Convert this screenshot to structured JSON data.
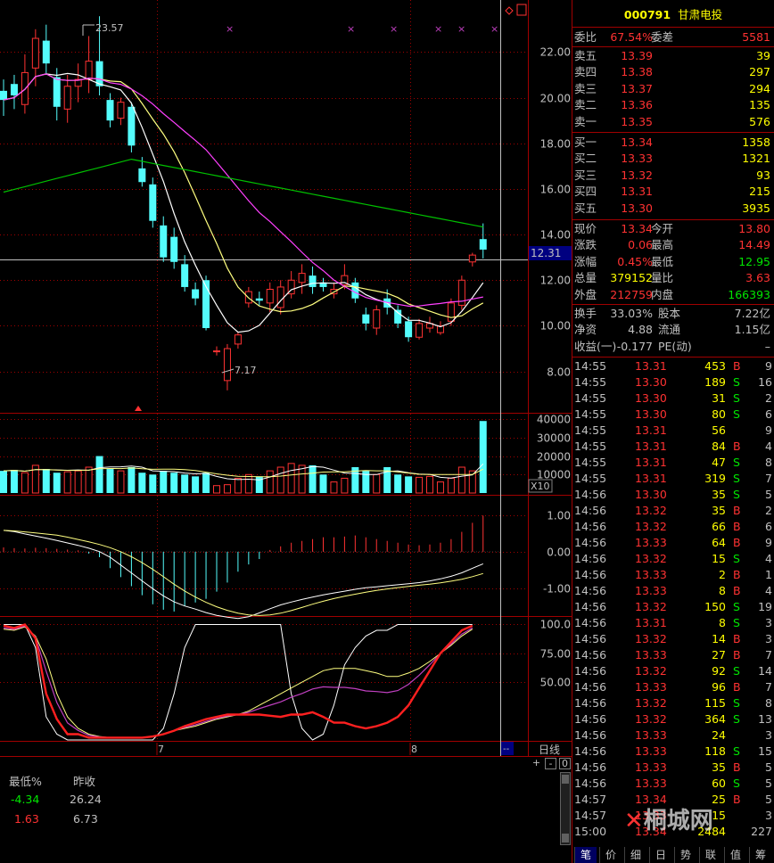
{
  "header": {
    "code": "000791",
    "name": "甘肃电投"
  },
  "quote_summary": [
    {
      "k1": "委比",
      "v1": "67.54%",
      "k2": "委差",
      "v2": "5581"
    }
  ],
  "sell_orders": [
    {
      "label": "卖五",
      "price": "13.39",
      "vol": "39"
    },
    {
      "label": "卖四",
      "price": "13.38",
      "vol": "297"
    },
    {
      "label": "卖三",
      "price": "13.37",
      "vol": "294"
    },
    {
      "label": "卖二",
      "price": "13.36",
      "vol": "135"
    },
    {
      "label": "卖一",
      "price": "13.35",
      "vol": "576"
    }
  ],
  "buy_orders": [
    {
      "label": "买一",
      "price": "13.34",
      "vol": "1358"
    },
    {
      "label": "买二",
      "price": "13.33",
      "vol": "1321"
    },
    {
      "label": "买三",
      "price": "13.32",
      "vol": "93"
    },
    {
      "label": "买四",
      "price": "13.31",
      "vol": "215"
    },
    {
      "label": "买五",
      "price": "13.30",
      "vol": "3935"
    }
  ],
  "stats": [
    {
      "k1": "现价",
      "v1": "13.34",
      "k2": "今开",
      "v2": "13.80"
    },
    {
      "k1": "涨跌",
      "v1": "0.06",
      "k2": "最高",
      "v2": "14.49"
    },
    {
      "k1": "涨幅",
      "v1": "0.45%",
      "k2": "最低",
      "v2": "12.95"
    },
    {
      "k1": "总量",
      "v1": "379152",
      "k2": "量比",
      "v2": "3.63"
    },
    {
      "k1": "外盘",
      "v1": "212759",
      "k2": "内盘",
      "v2": "166393"
    }
  ],
  "fund": [
    {
      "k1": "换手",
      "v1": "33.03%",
      "k2": "股本",
      "v2": "7.22亿"
    },
    {
      "k1": "净资",
      "v1": "4.88",
      "k2": "流通",
      "v2": "1.15亿"
    },
    {
      "k1": "收益(一)",
      "v1": "-0.177",
      "k2": "PE(动)",
      "v2": "–"
    }
  ],
  "ticks": [
    {
      "t": "14:55",
      "p": "13.31",
      "v": "453",
      "bs": "B",
      "n": "9"
    },
    {
      "t": "14:55",
      "p": "13.30",
      "v": "189",
      "bs": "S",
      "n": "16"
    },
    {
      "t": "14:55",
      "p": "13.30",
      "v": "31",
      "bs": "S",
      "n": "2"
    },
    {
      "t": "14:55",
      "p": "13.30",
      "v": "80",
      "bs": "S",
      "n": "6"
    },
    {
      "t": "14:55",
      "p": "13.31",
      "v": "56",
      "bs": "",
      "n": "9"
    },
    {
      "t": "14:55",
      "p": "13.31",
      "v": "84",
      "bs": "B",
      "n": "4"
    },
    {
      "t": "14:55",
      "p": "13.31",
      "v": "47",
      "bs": "S",
      "n": "8"
    },
    {
      "t": "14:55",
      "p": "13.31",
      "v": "319",
      "bs": "S",
      "n": "7"
    },
    {
      "t": "14:56",
      "p": "13.30",
      "v": "35",
      "bs": "S",
      "n": "5"
    },
    {
      "t": "14:56",
      "p": "13.32",
      "v": "35",
      "bs": "B",
      "n": "2"
    },
    {
      "t": "14:56",
      "p": "13.32",
      "v": "66",
      "bs": "B",
      "n": "6"
    },
    {
      "t": "14:56",
      "p": "13.33",
      "v": "64",
      "bs": "B",
      "n": "9"
    },
    {
      "t": "14:56",
      "p": "13.32",
      "v": "15",
      "bs": "S",
      "n": "4"
    },
    {
      "t": "14:56",
      "p": "13.33",
      "v": "2",
      "bs": "B",
      "n": "1"
    },
    {
      "t": "14:56",
      "p": "13.33",
      "v": "8",
      "bs": "B",
      "n": "4"
    },
    {
      "t": "14:56",
      "p": "13.32",
      "v": "150",
      "bs": "S",
      "n": "19"
    },
    {
      "t": "14:56",
      "p": "13.31",
      "v": "8",
      "bs": "S",
      "n": "3"
    },
    {
      "t": "14:56",
      "p": "13.32",
      "v": "14",
      "bs": "B",
      "n": "3"
    },
    {
      "t": "14:56",
      "p": "13.33",
      "v": "27",
      "bs": "B",
      "n": "7"
    },
    {
      "t": "14:56",
      "p": "13.32",
      "v": "92",
      "bs": "S",
      "n": "14"
    },
    {
      "t": "14:56",
      "p": "13.33",
      "v": "96",
      "bs": "B",
      "n": "7"
    },
    {
      "t": "14:56",
      "p": "13.32",
      "v": "115",
      "bs": "S",
      "n": "8"
    },
    {
      "t": "14:56",
      "p": "13.32",
      "v": "364",
      "bs": "S",
      "n": "13"
    },
    {
      "t": "14:56",
      "p": "13.33",
      "v": "24",
      "bs": "",
      "n": "3"
    },
    {
      "t": "14:56",
      "p": "13.33",
      "v": "118",
      "bs": "S",
      "n": "15"
    },
    {
      "t": "14:56",
      "p": "13.33",
      "v": "35",
      "bs": "B",
      "n": "5"
    },
    {
      "t": "14:56",
      "p": "13.33",
      "v": "60",
      "bs": "S",
      "n": "5"
    },
    {
      "t": "14:57",
      "p": "13.34",
      "v": "25",
      "bs": "B",
      "n": "5"
    },
    {
      "t": "14:57",
      "p": "13.33",
      "v": "15",
      "bs": "",
      "n": "3"
    },
    {
      "t": "15:00",
      "p": "13.34",
      "v": "2484",
      "bs": "",
      "n": "227"
    }
  ],
  "bottom_tabs": [
    "笔",
    "价",
    "细",
    "日",
    "势",
    "联",
    "值",
    "筹"
  ],
  "bottom_info": {
    "h1": "最低%",
    "h2": "昨收",
    "r1c1": "-4.34",
    "r1c2": "26.24",
    "r2c1": "1.63",
    "r2c2": "6.73"
  },
  "toolbar": {
    "period_label": "日线",
    "plus": "+",
    "minus": "-",
    "zero": "0",
    "collapse": "--"
  },
  "watermark": "桐城网",
  "colors": {
    "up": "#ff3232",
    "down": "#54fcfc",
    "gold": "#ffff00",
    "green": "#00e600",
    "grid": "#a00000",
    "text": "#c0c0c0"
  },
  "chart_data": {
    "type": "candlestick",
    "price_axis": {
      "min": 6.5,
      "max": 23.5,
      "ticks": [
        "22.00",
        "20.00",
        "18.00",
        "16.00",
        "14.00",
        "12.00",
        "10.00",
        "8.00"
      ],
      "current_marker": "12.31",
      "high_label": "23.57",
      "low_label": "7.17"
    },
    "volume_axis": {
      "ticks": [
        "40000",
        "30000",
        "20000",
        "10000"
      ],
      "unit": "X10",
      "max": 42000
    },
    "macd_axis": {
      "ticks": [
        "1.00",
        "0.00",
        "-1.00"
      ],
      "min": -1.75,
      "max": 1.45
    },
    "kdj_axis": {
      "ticks": [
        "100.0",
        "75.00",
        "50.00"
      ],
      "min": 0,
      "max": 105
    },
    "x_labels": [
      "7",
      "8"
    ],
    "candles": [
      {
        "o": 20.3,
        "c": 19.9,
        "h": 20.8,
        "l": 19.2
      },
      {
        "o": 20.6,
        "c": 20.1,
        "h": 21.0,
        "l": 19.5
      },
      {
        "o": 19.7,
        "c": 21.1,
        "h": 21.9,
        "l": 19.3
      },
      {
        "o": 21.3,
        "c": 22.6,
        "h": 23.0,
        "l": 20.5
      },
      {
        "o": 22.5,
        "c": 21.5,
        "h": 23.2,
        "l": 21.0
      },
      {
        "o": 20.9,
        "c": 19.6,
        "h": 21.3,
        "l": 19.0
      },
      {
        "o": 19.5,
        "c": 20.5,
        "h": 21.0,
        "l": 18.9
      },
      {
        "o": 20.5,
        "c": 20.8,
        "h": 21.5,
        "l": 19.8
      },
      {
        "o": 20.8,
        "c": 21.6,
        "h": 22.7,
        "l": 20.2
      },
      {
        "o": 21.6,
        "c": 20.5,
        "h": 23.57,
        "l": 20.1
      },
      {
        "o": 19.9,
        "c": 19.0,
        "h": 20.2,
        "l": 18.7
      },
      {
        "o": 19.1,
        "c": 19.8,
        "h": 20.0,
        "l": 18.8
      },
      {
        "o": 19.6,
        "c": 17.9,
        "h": 19.8,
        "l": 17.6
      },
      {
        "o": 16.9,
        "c": 16.3,
        "h": 17.4,
        "l": 16.1
      },
      {
        "o": 16.2,
        "c": 14.6,
        "h": 16.5,
        "l": 14.3
      },
      {
        "o": 14.4,
        "c": 13.0,
        "h": 14.8,
        "l": 12.8
      },
      {
        "o": 13.9,
        "c": 12.8,
        "h": 14.3,
        "l": 12.5
      },
      {
        "o": 12.7,
        "c": 11.7,
        "h": 13.1,
        "l": 11.5
      },
      {
        "o": 11.6,
        "c": 11.2,
        "h": 11.9,
        "l": 10.9
      },
      {
        "o": 12.0,
        "c": 9.9,
        "h": 12.2,
        "l": 9.8
      },
      {
        "o": 8.9,
        "c": 8.9,
        "h": 9.1,
        "l": 8.7
      },
      {
        "o": 7.6,
        "c": 9.0,
        "h": 9.2,
        "l": 7.17
      },
      {
        "o": 9.2,
        "c": 9.6,
        "h": 9.7,
        "l": 9.0
      },
      {
        "o": 11.0,
        "c": 11.5,
        "h": 11.7,
        "l": 10.8
      },
      {
        "o": 11.2,
        "c": 11.1,
        "h": 11.5,
        "l": 10.9
      },
      {
        "o": 11.0,
        "c": 11.6,
        "h": 11.9,
        "l": 10.6
      },
      {
        "o": 10.8,
        "c": 11.7,
        "h": 12.0,
        "l": 10.5
      },
      {
        "o": 11.4,
        "c": 12.0,
        "h": 12.4,
        "l": 11.2
      },
      {
        "o": 11.9,
        "c": 12.3,
        "h": 12.7,
        "l": 11.4
      },
      {
        "o": 12.2,
        "c": 11.7,
        "h": 12.6,
        "l": 11.4
      },
      {
        "o": 11.9,
        "c": 11.7,
        "h": 12.1,
        "l": 11.5
      },
      {
        "o": 11.4,
        "c": 11.6,
        "h": 11.9,
        "l": 11.2
      },
      {
        "o": 11.8,
        "c": 12.2,
        "h": 12.7,
        "l": 11.6
      },
      {
        "o": 11.9,
        "c": 11.2,
        "h": 12.1,
        "l": 11.0
      },
      {
        "o": 10.5,
        "c": 10.1,
        "h": 10.8,
        "l": 9.8
      },
      {
        "o": 9.9,
        "c": 10.7,
        "h": 10.9,
        "l": 9.6
      },
      {
        "o": 11.2,
        "c": 10.8,
        "h": 11.6,
        "l": 10.5
      },
      {
        "o": 10.7,
        "c": 10.1,
        "h": 10.9,
        "l": 9.9
      },
      {
        "o": 10.2,
        "c": 9.5,
        "h": 10.4,
        "l": 9.3
      },
      {
        "o": 9.5,
        "c": 10.1,
        "h": 10.3,
        "l": 9.4
      },
      {
        "o": 9.9,
        "c": 10.1,
        "h": 10.4,
        "l": 9.7
      },
      {
        "o": 9.7,
        "c": 10.0,
        "h": 10.2,
        "l": 9.6
      },
      {
        "o": 10.2,
        "c": 11.0,
        "h": 11.2,
        "l": 10.0
      },
      {
        "o": 10.9,
        "c": 12.0,
        "h": 12.2,
        "l": 10.7
      },
      {
        "o": 12.8,
        "c": 13.1,
        "h": 13.2,
        "l": 12.6
      },
      {
        "o": 13.8,
        "c": 13.34,
        "h": 14.49,
        "l": 12.95
      }
    ],
    "volume": [
      12000,
      12500,
      11000,
      15000,
      13000,
      11000,
      11500,
      12000,
      14000,
      20000,
      13000,
      12000,
      14000,
      11000,
      10000,
      12000,
      11000,
      10000,
      9000,
      11000,
      4000,
      4500,
      8000,
      10000,
      9000,
      12000,
      14000,
      16000,
      15000,
      15000,
      10000,
      6000,
      8000,
      14000,
      12000,
      10000,
      14000,
      10000,
      9000,
      8500,
      9000,
      6000,
      8000,
      14000,
      12000,
      39000
    ],
    "macd_hist": [
      0.12,
      0.1,
      0.09,
      0.11,
      0.1,
      0.08,
      0.06,
      0.04,
      -0.05,
      -0.15,
      -0.45,
      -0.7,
      -0.95,
      -1.2,
      -1.45,
      -1.6,
      -1.65,
      -1.5,
      -1.4,
      -1.3,
      -1.1,
      -0.85,
      -0.55,
      -0.35,
      -0.2,
      0.05,
      0.15,
      0.25,
      0.3,
      0.35,
      0.4,
      0.4,
      0.42,
      0.45,
      0.4,
      0.35,
      0.3,
      0.25,
      0.2,
      0.18,
      0.2,
      0.25,
      0.35,
      0.55,
      0.8,
      1.0
    ],
    "kdj_k": [
      99,
      97,
      100,
      88,
      40,
      18,
      5,
      5,
      2,
      2,
      2,
      2,
      2,
      2,
      3,
      5,
      8,
      12,
      15,
      18,
      20,
      22,
      22,
      22,
      22,
      21,
      20,
      22,
      22,
      24,
      20,
      15,
      15,
      12,
      10,
      12,
      15,
      20,
      30,
      45,
      60,
      75,
      85,
      95,
      99
    ],
    "kdj_d": [
      96,
      95,
      98,
      90,
      70,
      40,
      20,
      10,
      5,
      3,
      2,
      2,
      2,
      2,
      3,
      5,
      8,
      10,
      12,
      15,
      18,
      20,
      22,
      25,
      30,
      35,
      40,
      45,
      50,
      55,
      60,
      62,
      62,
      62,
      60,
      58,
      55,
      55,
      58,
      62,
      68,
      75,
      82,
      90,
      96
    ],
    "kdj_j": [
      100,
      100,
      100,
      80,
      20,
      5,
      0,
      0,
      0,
      0,
      0,
      0,
      0,
      0,
      0,
      10,
      40,
      80,
      100,
      100,
      100,
      100,
      100,
      100,
      100,
      100,
      100,
      40,
      10,
      0,
      5,
      30,
      65,
      80,
      90,
      95,
      95,
      100,
      100,
      100,
      100,
      100,
      100,
      100,
      100
    ]
  }
}
